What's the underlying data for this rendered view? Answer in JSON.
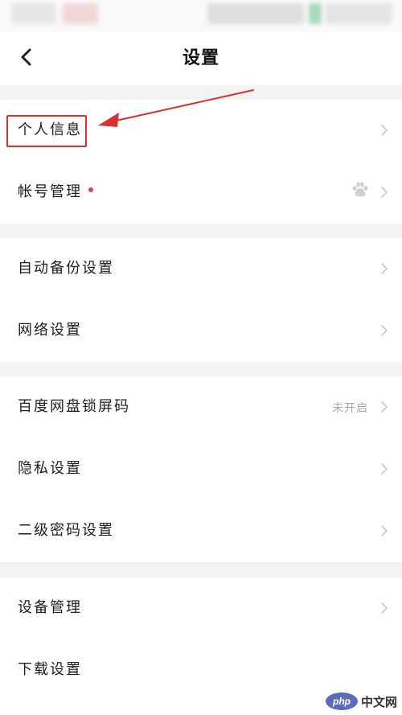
{
  "header": {
    "title": "设置",
    "back_icon": "chevron-left-icon"
  },
  "groups": [
    {
      "items": [
        {
          "label": "个人信息",
          "icon": "chevron-right-icon"
        },
        {
          "label": "帐号管理",
          "badge": "red-dot",
          "trailing_icon": "baidu-paw-icon",
          "icon": "chevron-right-icon"
        }
      ]
    },
    {
      "items": [
        {
          "label": "自动备份设置",
          "icon": "chevron-right-icon"
        },
        {
          "label": "网络设置",
          "icon": "chevron-right-icon"
        }
      ]
    },
    {
      "items": [
        {
          "label": "百度网盘锁屏码",
          "value": "未开启",
          "icon": "chevron-right-icon"
        },
        {
          "label": "隐私设置",
          "icon": "chevron-right-icon"
        },
        {
          "label": "二级密码设置",
          "icon": "chevron-right-icon"
        }
      ]
    },
    {
      "items": [
        {
          "label": "设备管理",
          "icon": "chevron-right-icon"
        },
        {
          "label": "下载设置",
          "icon": "chevron-right-icon"
        }
      ]
    }
  ],
  "annotation": {
    "color": "#d8302a",
    "target": "个人信息"
  },
  "watermark": {
    "logo": "php",
    "text": "中文网"
  },
  "colors": {
    "background": "#f3f3f3",
    "card": "#ffffff",
    "badge": "#e0405a",
    "secondary_text": "#a7a7a7"
  }
}
